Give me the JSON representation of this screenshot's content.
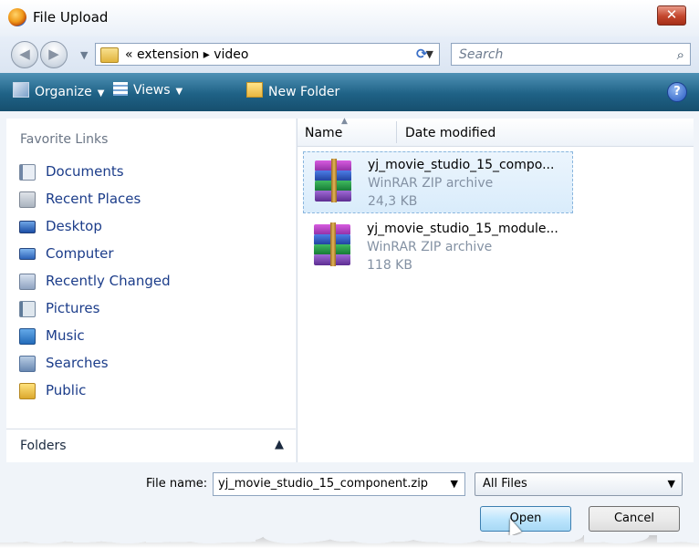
{
  "window": {
    "title": "File Upload",
    "close_label": "✕"
  },
  "address": {
    "path": "« extension ▸ video",
    "search_placeholder": "Search"
  },
  "toolbar": {
    "organize": "Organize",
    "views": "Views",
    "new_folder": "New Folder"
  },
  "left_pane": {
    "title": "Favorite Links",
    "links": [
      {
        "label": "Documents"
      },
      {
        "label": "Recent Places"
      },
      {
        "label": "Desktop"
      },
      {
        "label": "Computer"
      },
      {
        "label": "Recently Changed"
      },
      {
        "label": "Pictures"
      },
      {
        "label": "Music"
      },
      {
        "label": "Searches"
      },
      {
        "label": "Public"
      }
    ],
    "folders_label": "Folders"
  },
  "columns": {
    "name": "Name",
    "date_modified": "Date modified"
  },
  "files": [
    {
      "name": "yj_movie_studio_15_compo...",
      "type": "WinRAR ZIP archive",
      "size": "24,3 KB",
      "selected": true
    },
    {
      "name": "yj_movie_studio_15_module...",
      "type": "WinRAR ZIP archive",
      "size": "118 KB",
      "selected": false
    }
  ],
  "bottom": {
    "file_name_label": "File name:",
    "file_name_value": "yj_movie_studio_15_component.zip",
    "file_type_value": "All Files",
    "open_label": "Open",
    "cancel_label": "Cancel"
  },
  "colors": {
    "command_bar": "#1f6286",
    "link_text": "#1c3d8a",
    "selection": "#d9ecfb"
  }
}
